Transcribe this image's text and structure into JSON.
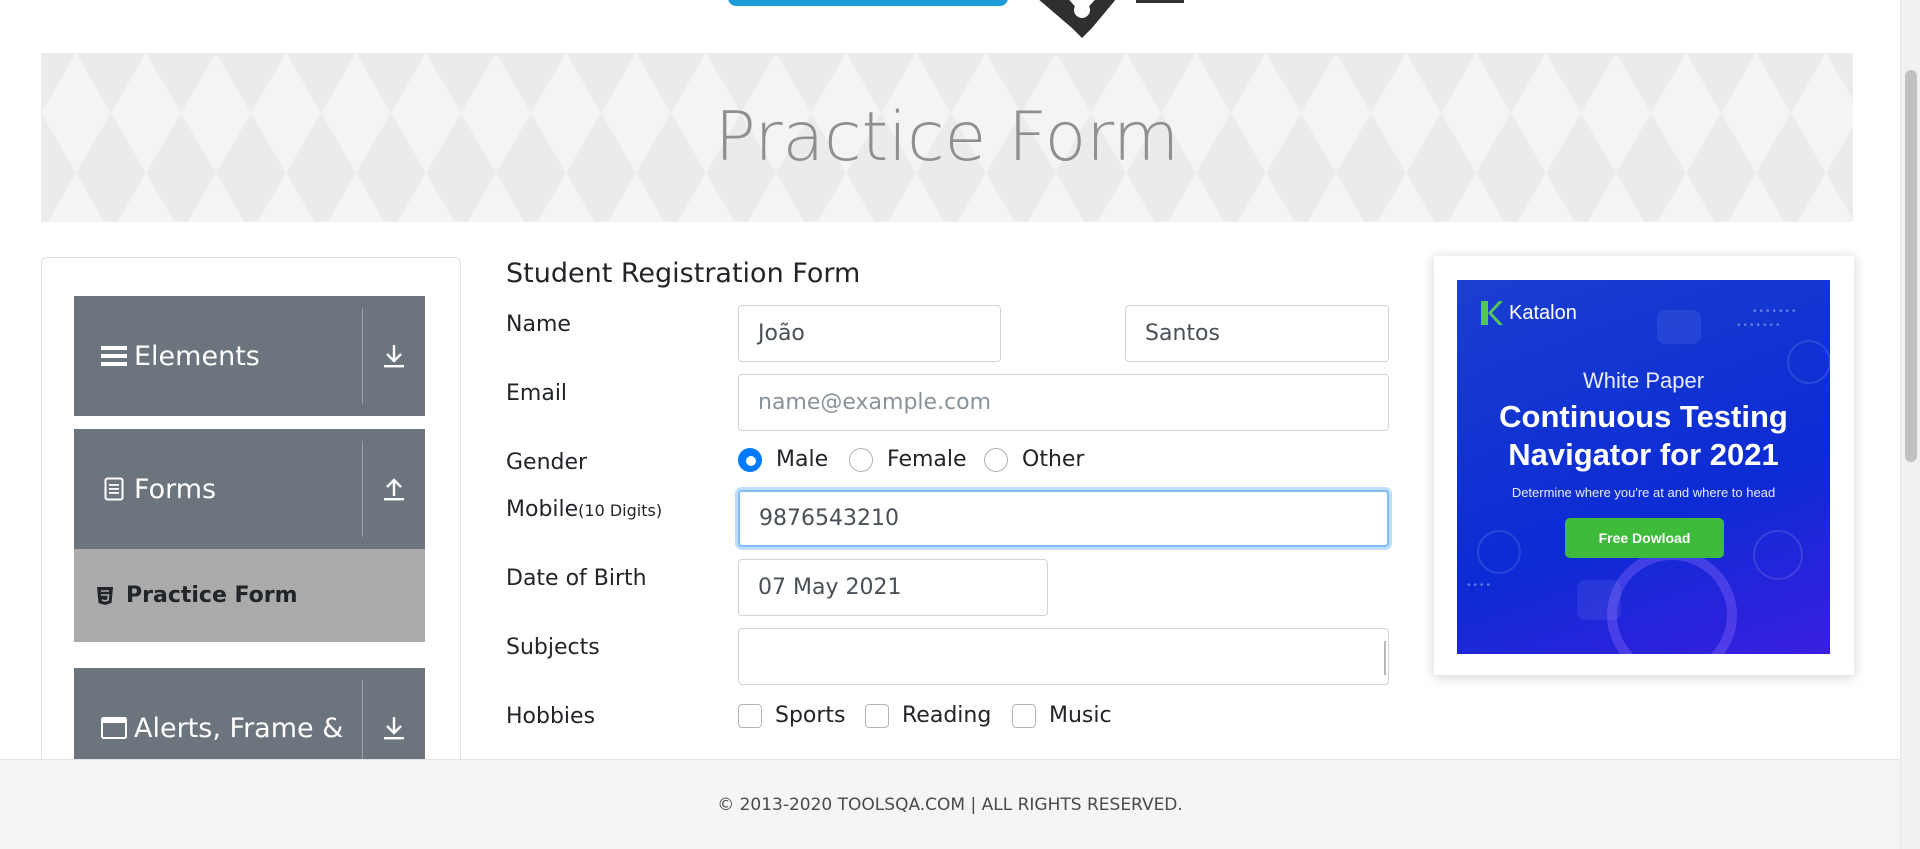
{
  "banner": {
    "title": "Practice Form"
  },
  "sidebar": {
    "groups": [
      {
        "label": "Elements",
        "icon": "hamburger-icon",
        "toggle": "download-icon"
      },
      {
        "label": "Forms",
        "icon": "document-icon",
        "toggle": "upload-icon"
      },
      {
        "label": "Alerts, Frame &",
        "icon": "browser-window-icon",
        "toggle": "download-icon"
      }
    ],
    "active_item": {
      "label": "Practice Form",
      "icon": "html5-icon"
    }
  },
  "form": {
    "title": "Student Registration Form",
    "name": {
      "label": "Name",
      "first_name": "João",
      "last_name": "Santos"
    },
    "email": {
      "label": "Email",
      "placeholder": "name@example.com"
    },
    "gender": {
      "label": "Gender",
      "options": [
        "Male",
        "Female",
        "Other"
      ],
      "selected": "Male"
    },
    "mobile": {
      "label": "Mobile",
      "hint": "(10 Digits)",
      "value": "9876543210"
    },
    "dob": {
      "label": "Date of Birth",
      "value": "07 May 2021"
    },
    "subjects": {
      "label": "Subjects",
      "value": ""
    },
    "hobbies": {
      "label": "Hobbies",
      "options": [
        "Sports",
        "Reading",
        "Music"
      ]
    }
  },
  "ad": {
    "brand": "Katalon",
    "kicker": "White Paper",
    "headline_line1": "Continuous Testing",
    "headline_line2": "Navigator for 2021",
    "sub": "Determine where you're at and where to head",
    "cta": "Free Dowload",
    "brand_color": "#1a3fd0",
    "cta_color": "#3fbb3b"
  },
  "footer": {
    "text": "© 2013-2020 TOOLSQA.COM | ALL RIGHTS RESERVED."
  },
  "colors": {
    "accent": "#007bff",
    "sidebar_header": "#6c757d",
    "active_item": "#aaaaaa"
  }
}
